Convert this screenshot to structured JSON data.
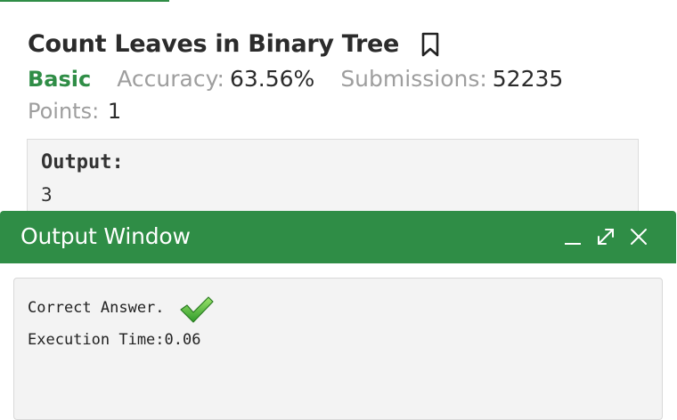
{
  "problem": {
    "title": "Count Leaves in Binary Tree",
    "difficulty": "Basic",
    "accuracy_label": "Accuracy:",
    "accuracy_value": "63.56%",
    "submissions_label": "Submissions:",
    "submissions_value": "52235",
    "points_label": "Points:",
    "points_value": "1"
  },
  "example": {
    "output_label": "Output:",
    "output_value": "3"
  },
  "output_window": {
    "title": "Output Window",
    "result_text": "Correct Answer.",
    "execution_time": "Execution Time:0.06"
  },
  "colors": {
    "brand_green": "#2f8d46",
    "muted_gray": "#9e9e9e"
  },
  "icons": [
    "bookmark-icon",
    "minimize-icon",
    "expand-icon",
    "close-icon",
    "checkmark-icon"
  ]
}
